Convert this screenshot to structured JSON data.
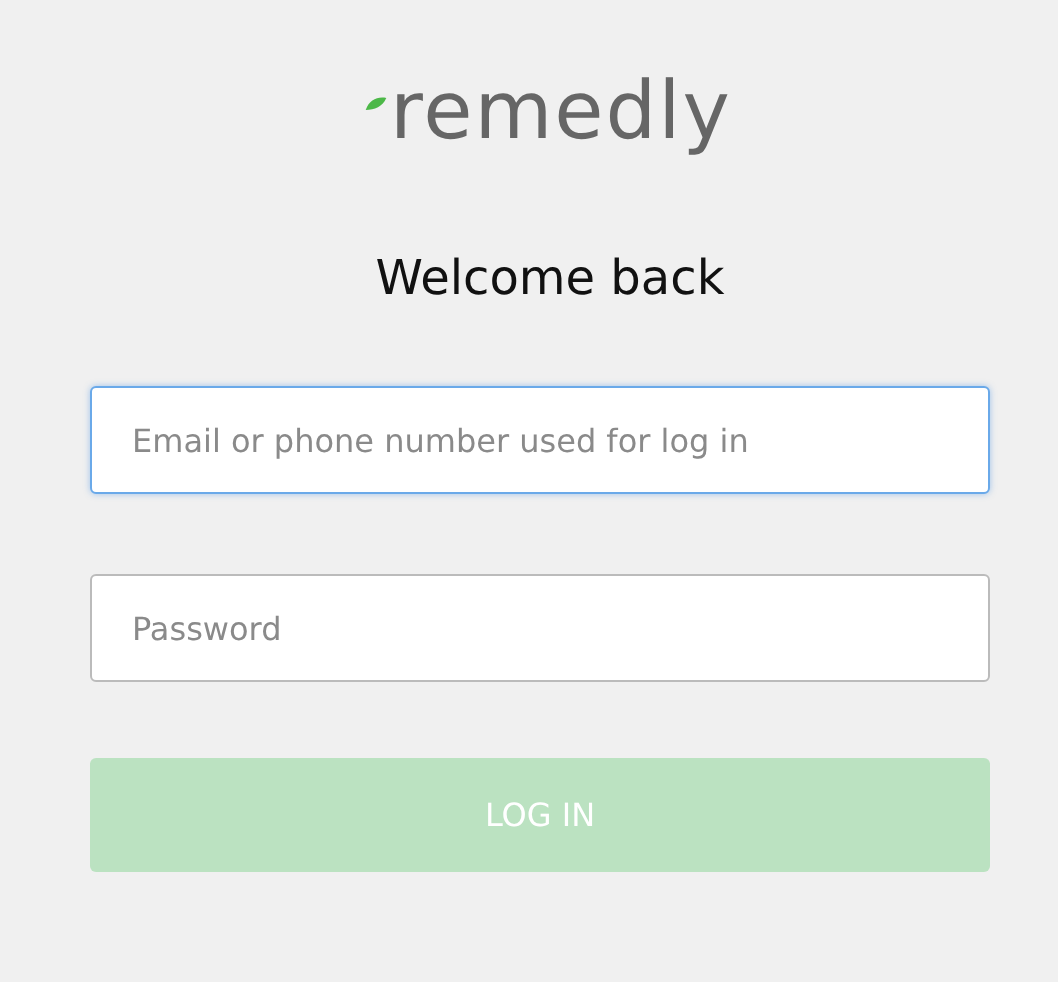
{
  "logo": {
    "text": "remedly"
  },
  "heading": "Welcome back",
  "fields": [
    {
      "placeholder": "Email or phone number used for log in",
      "focused": true
    },
    {
      "placeholder": "Password",
      "focused": false
    }
  ],
  "login_button": {
    "label": "LOG IN",
    "disabled": true
  }
}
